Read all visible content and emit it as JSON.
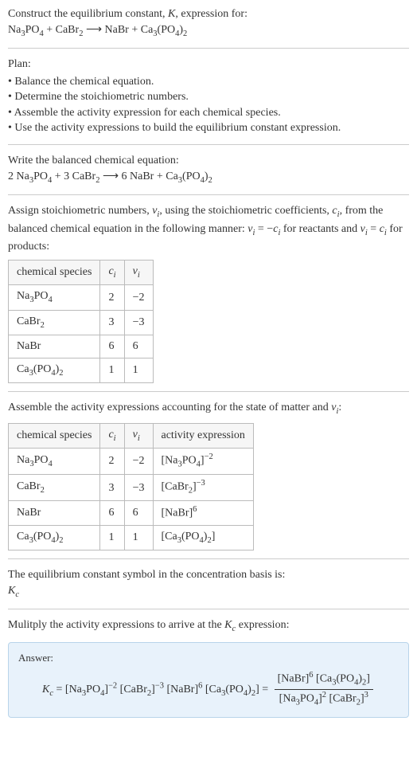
{
  "intro": {
    "line1": "Construct the equilibrium constant, <span class=\"ital\">K</span>, expression for:",
    "eq": "Na<sub>3</sub>PO<sub>4</sub> + CaBr<sub>2</sub> ⟶ NaBr + Ca<sub>3</sub>(PO<sub>4</sub>)<sub>2</sub>"
  },
  "plan": {
    "title": "Plan:",
    "items": [
      "Balance the chemical equation.",
      "Determine the stoichiometric numbers.",
      "Assemble the activity expression for each chemical species.",
      "Use the activity expressions to build the equilibrium constant expression."
    ]
  },
  "balanced": {
    "title": "Write the balanced chemical equation:",
    "eq": "2 Na<sub>3</sub>PO<sub>4</sub> + 3 CaBr<sub>2</sub> ⟶ 6 NaBr + Ca<sub>3</sub>(PO<sub>4</sub>)<sub>2</sub>"
  },
  "assign": {
    "text": "Assign stoichiometric numbers, <span class=\"ital\">ν<sub>i</sub></span>, using the stoichiometric coefficients, <span class=\"ital\">c<sub>i</sub></span>, from the balanced chemical equation in the following manner: <span class=\"ital\">ν<sub>i</sub></span> = −<span class=\"ital\">c<sub>i</sub></span> for reactants and <span class=\"ital\">ν<sub>i</sub></span> = <span class=\"ital\">c<sub>i</sub></span> for products:",
    "headers": [
      "chemical species",
      "<span class=\"ital\">c<sub>i</sub></span>",
      "<span class=\"ital\">ν<sub>i</sub></span>"
    ],
    "rows": [
      [
        "Na<sub>3</sub>PO<sub>4</sub>",
        "2",
        "−2"
      ],
      [
        "CaBr<sub>2</sub>",
        "3",
        "−3"
      ],
      [
        "NaBr",
        "6",
        "6"
      ],
      [
        "Ca<sub>3</sub>(PO<sub>4</sub>)<sub>2</sub>",
        "1",
        "1"
      ]
    ]
  },
  "activity": {
    "text": "Assemble the activity expressions accounting for the state of matter and <span class=\"ital\">ν<sub>i</sub></span>:",
    "headers": [
      "chemical species",
      "<span class=\"ital\">c<sub>i</sub></span>",
      "<span class=\"ital\">ν<sub>i</sub></span>",
      "activity expression"
    ],
    "rows": [
      [
        "Na<sub>3</sub>PO<sub>4</sub>",
        "2",
        "−2",
        "[Na<sub>3</sub>PO<sub>4</sub>]<sup>−2</sup>"
      ],
      [
        "CaBr<sub>2</sub>",
        "3",
        "−3",
        "[CaBr<sub>2</sub>]<sup>−3</sup>"
      ],
      [
        "NaBr",
        "6",
        "6",
        "[NaBr]<sup>6</sup>"
      ],
      [
        "Ca<sub>3</sub>(PO<sub>4</sub>)<sub>2</sub>",
        "1",
        "1",
        "[Ca<sub>3</sub>(PO<sub>4</sub>)<sub>2</sub>]"
      ]
    ]
  },
  "symbol": {
    "line1": "The equilibrium constant symbol in the concentration basis is:",
    "line2": "<span class=\"ital\">K<sub>c</sub></span>"
  },
  "multiply": {
    "text": "Mulitply the activity expressions to arrive at the <span class=\"ital\">K<sub>c</sub></span> expression:"
  },
  "answer": {
    "label": "Answer:",
    "lhs": "<span class=\"ital\">K<sub>c</sub></span> = [Na<sub>3</sub>PO<sub>4</sub>]<sup>−2</sup> [CaBr<sub>2</sub>]<sup>−3</sup> [NaBr]<sup>6</sup> [Ca<sub>3</sub>(PO<sub>4</sub>)<sub>2</sub>] = ",
    "frac_num": "[NaBr]<sup>6</sup> [Ca<sub>3</sub>(PO<sub>4</sub>)<sub>2</sub>]",
    "frac_den": "[Na<sub>3</sub>PO<sub>4</sub>]<sup>2</sup> [CaBr<sub>2</sub>]<sup>3</sup>"
  }
}
